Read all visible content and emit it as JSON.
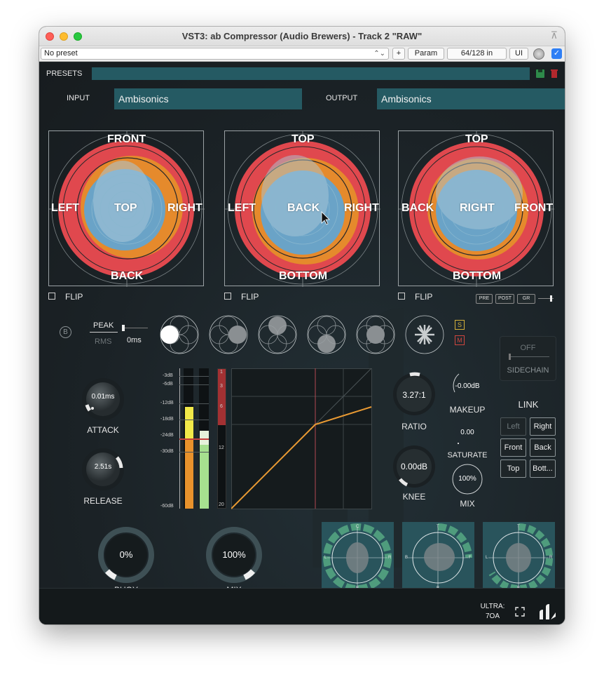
{
  "window": {
    "title": "VST3: ab Compressor (Audio Brewers) - Track 2 \"RAW\""
  },
  "host": {
    "preset": "No preset",
    "plus": "+",
    "param": "Param",
    "io": "64/128 in",
    "ui": "UI"
  },
  "presets": {
    "label": "PRESETS"
  },
  "io": {
    "input_label": "INPUT",
    "input_value": "Ambisonics",
    "output_label": "OUTPUT",
    "output_value": "Ambisonics"
  },
  "spheres": [
    {
      "top": "FRONT",
      "bottom": "BACK",
      "left": "LEFT",
      "right": "RIGHT",
      "center": "TOP",
      "flip": "FLIP"
    },
    {
      "top": "TOP",
      "bottom": "BOTTOM",
      "left": "LEFT",
      "right": "RIGHT",
      "center": "BACK",
      "flip": "FLIP"
    },
    {
      "top": "TOP",
      "bottom": "BOTTOM",
      "left": "BACK",
      "right": "FRONT",
      "center": "RIGHT",
      "flip": "FLIP"
    }
  ],
  "meter_buttons": {
    "pre": "PRE",
    "post": "POST",
    "gr": "GR"
  },
  "detector": {
    "b": "B",
    "peak": "PEAK",
    "rms": "RMS",
    "time": "0ms",
    "s": "S",
    "m": "M"
  },
  "sidechain": {
    "state": "OFF",
    "label": "SIDECHAIN"
  },
  "attack": {
    "value": "0.01ms",
    "label": "ATTACK"
  },
  "release": {
    "value": "2.51s",
    "label": "RELEASE"
  },
  "meter": {
    "scale": [
      "-3dB",
      "-6dB",
      "-12dB",
      "-18dB",
      "-24dB",
      "-30dB",
      "-60dB"
    ],
    "gr_scale": [
      "1",
      "3",
      "6",
      "12",
      "20"
    ]
  },
  "ratio": {
    "value": "3.27:1",
    "label": "RATIO"
  },
  "knee": {
    "value": "0.00dB",
    "label": "KNEE"
  },
  "makeup": {
    "value": "-0.00dB",
    "label": "MAKEUP"
  },
  "saturate": {
    "value": "0.00",
    "label": "SATURATE"
  },
  "mix_small": {
    "value": "100%",
    "label": "MIX"
  },
  "link": {
    "title": "LINK",
    "buttons": [
      "Left",
      "Right",
      "Front",
      "Back",
      "Top",
      "Bott..."
    ]
  },
  "buoy": {
    "value": "0%",
    "label": "BUOY"
  },
  "mix": {
    "value": "100%",
    "label": "MIX"
  },
  "visualizers": [
    {
      "top": "C",
      "bottom": "B",
      "left": "L",
      "right": "R"
    },
    {
      "top": "T",
      "bottom": "B",
      "left": "B",
      "right": "F"
    },
    {
      "top": "T",
      "bottom": "B",
      "left": "L",
      "right": "R"
    }
  ],
  "footer": {
    "mode_line1": "ULTRA:",
    "mode_line2": "7OA"
  },
  "colors": {
    "accent": "#255a63",
    "red": "#e0484e",
    "orange": "#e58a2c",
    "blue": "#6aa3c7",
    "meter_yellow": "#f1e949",
    "meter_green": "#a6e08f"
  }
}
